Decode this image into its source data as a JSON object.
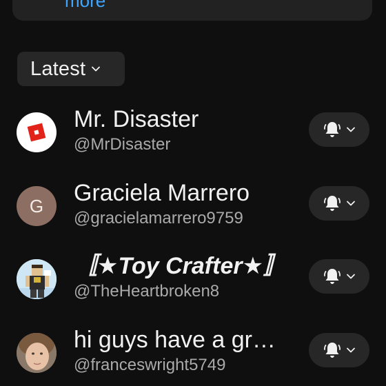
{
  "top_card": {
    "more_label": "more"
  },
  "sort": {
    "label": "Latest"
  },
  "channels": [
    {
      "name": "Mr. Disaster",
      "handle": "@MrDisaster",
      "avatar": "roblox-logo"
    },
    {
      "name": "Graciela Marrero",
      "handle": "@gracielamarrero9759",
      "avatar_letter": "G"
    },
    {
      "name": "〚★Toy Crafter★〛",
      "handle": "@TheHeartbroken8",
      "avatar": "roblox-character"
    },
    {
      "name": "hi guys have a gr…",
      "handle": "@franceswright5749",
      "avatar": "person-photo"
    }
  ],
  "colors": {
    "background": "#0f0f0f",
    "chip": "#272727",
    "link": "#3ea6ff",
    "secondary_text": "#aaaaaa"
  }
}
